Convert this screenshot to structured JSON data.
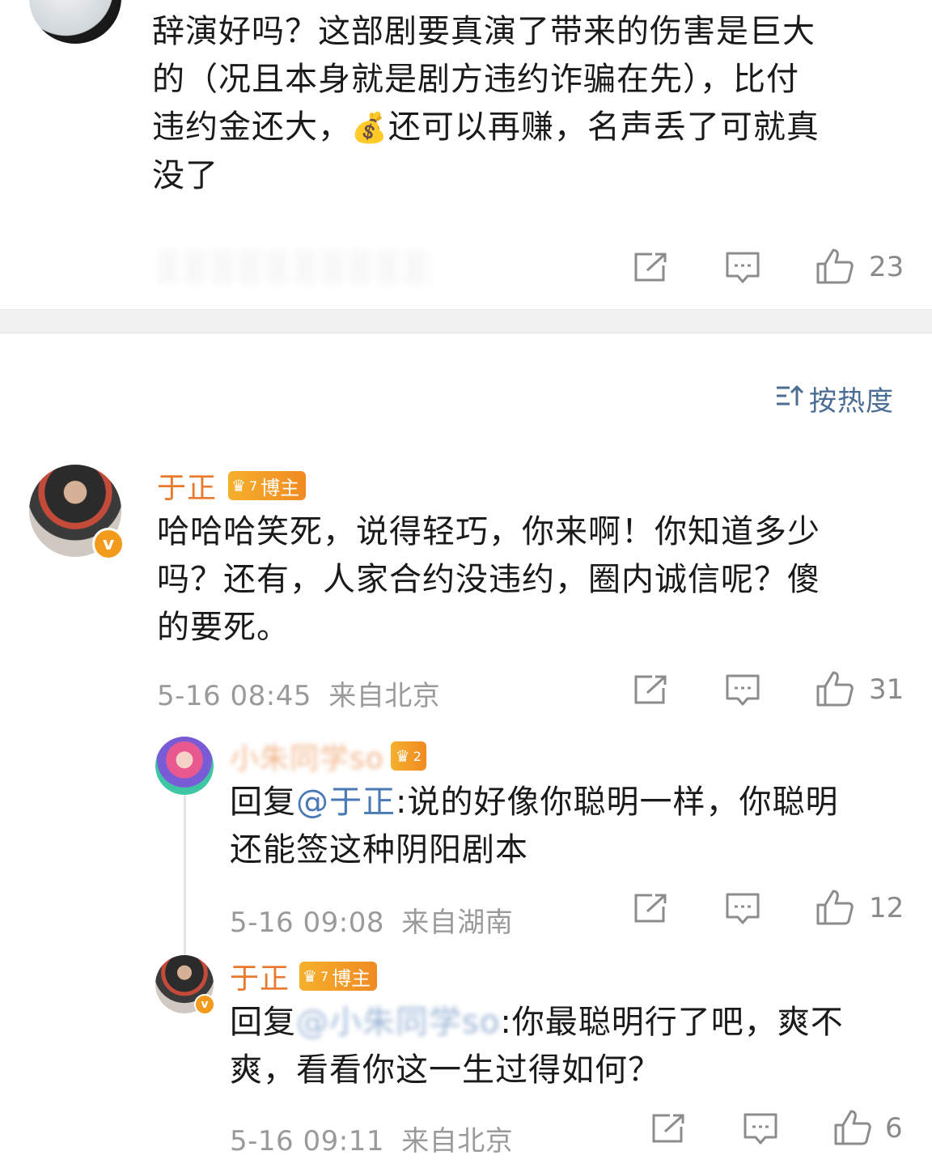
{
  "top_comment": {
    "lines": [
      "辞演好吗？这部剧要真演了带来的伤害是巨大",
      "的（况且本身就是剧方违约诈骗在先），比付",
      "违约金还大，",
      "还可以再赚，名声丢了可就真",
      "没了"
    ],
    "emoji": "💰",
    "like_count": "23"
  },
  "sort": {
    "label": "按热度"
  },
  "comment1": {
    "user": "于正",
    "badge_label": "博主",
    "badge_level": "7",
    "lines": [
      "哈哈哈笑死，说得轻巧，你来啊！你知道多少",
      "吗？还有，人家合约没违约，圈内诚信呢？傻",
      "的要死。"
    ],
    "time": "5-16 08:45",
    "location": "来自北京",
    "like_count": "31"
  },
  "reply1": {
    "user": "小朱同学so",
    "badge_level": "2",
    "prefix": "回复",
    "mention": "@于正",
    "lines": [
      ":说的好像你聪明一样，你聪明",
      "还能签这种阴阳剧本"
    ],
    "time": "5-16 09:08",
    "location": "来自湖南",
    "like_count": "12"
  },
  "reply2": {
    "user": "于正",
    "badge_label": "博主",
    "badge_level": "7",
    "prefix": "回复",
    "mention": "@小朱同学so",
    "lines": [
      ":你最聪明行了吧，爽不",
      "爽，看看你这一生过得如何？"
    ],
    "time": "5-16 09:11",
    "location": "来自北京",
    "like_count": "6"
  },
  "icons": {
    "share": "share-icon",
    "comment": "comment-icon",
    "like": "thumbs-up-icon",
    "verified": "verified-v-icon",
    "crown": "crown-badge-icon",
    "sort": "sort-icon"
  },
  "colors": {
    "username": "#e8792d",
    "mention": "#4a7ab5",
    "sort": "#4a6d93",
    "meta": "#9a9a9a"
  }
}
